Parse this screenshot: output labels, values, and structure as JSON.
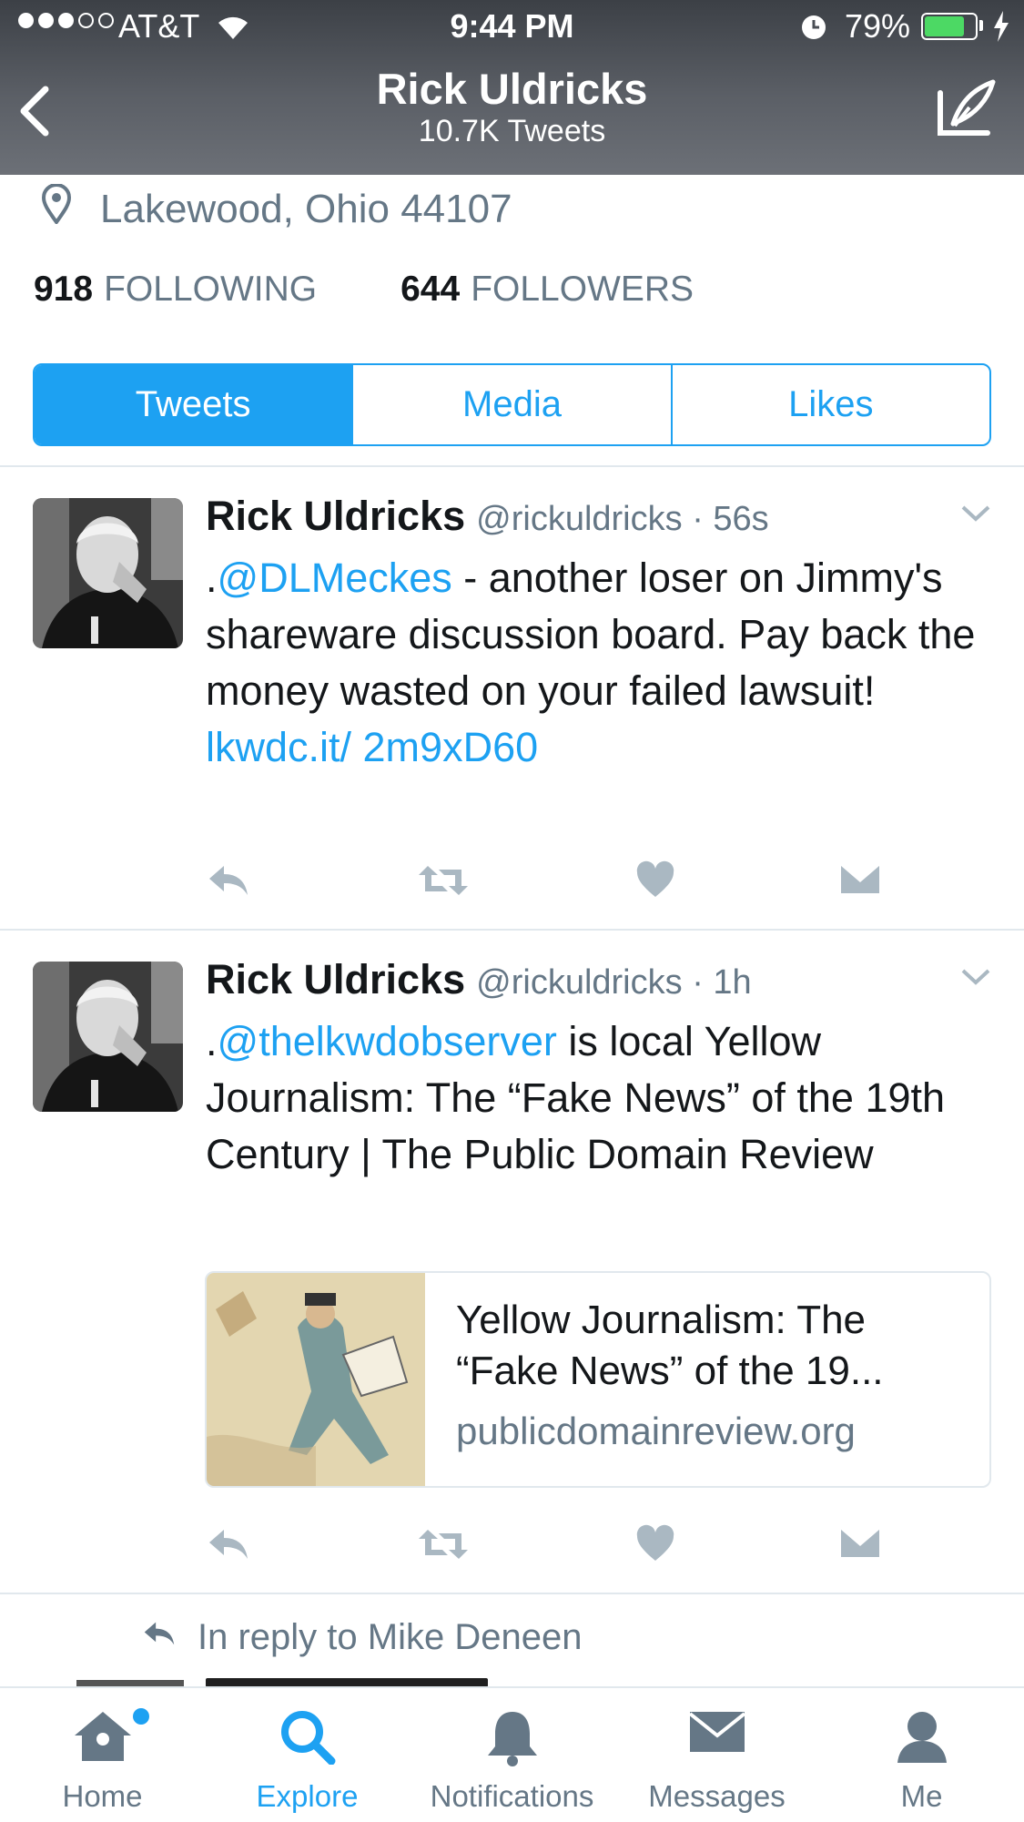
{
  "status_bar": {
    "carrier": "AT&T",
    "time": "9:44 PM",
    "battery": "79%",
    "battery_level": 0.79,
    "signal_bars_filled": 3,
    "signal_bars_total": 5
  },
  "header": {
    "title": "Rick Uldricks",
    "subtitle": "10.7K Tweets"
  },
  "profile": {
    "location": "Lakewood, Ohio 44107",
    "following_count": "918",
    "following_label": "FOLLOWING",
    "followers_count": "644",
    "followers_label": "FOLLOWERS"
  },
  "tabs": [
    "Tweets",
    "Media",
    "Likes"
  ],
  "active_tab": "Tweets",
  "tweets": [
    {
      "name": "Rick Uldricks",
      "handle": "@rickuldricks",
      "sep": "·",
      "time": "56s",
      "prefix": ".",
      "mention": "@DLMeckes",
      "text": " - another loser on Jimmy's shareware discussion board. Pay back the money wasted on your failed lawsuit! ",
      "link": "lkwdc.it/ 2m9xD60"
    },
    {
      "name": "Rick Uldricks",
      "handle": "@rickuldricks",
      "sep": "·",
      "time": "1h",
      "prefix": ".",
      "mention": "@thelkwdobserver",
      "text": " is local Yellow Journalism: The “Fake News” of the 19th Century | The Public Domain Review",
      "card": {
        "title": "Yellow Journalism: The “Fake News” of the 19...",
        "domain": "publicdomainreview.org"
      }
    }
  ],
  "reply_context": "In reply to Mike Deneen",
  "bottom_nav": [
    {
      "label": "Home",
      "icon": "home-icon"
    },
    {
      "label": "Explore",
      "icon": "search-icon"
    },
    {
      "label": "Notifications",
      "icon": "bell-icon"
    },
    {
      "label": "Messages",
      "icon": "envelope-icon"
    },
    {
      "label": "Me",
      "icon": "person-icon"
    }
  ],
  "active_nav": "Explore",
  "colors": {
    "accent": "#1da1f2",
    "secondary_text": "#657786",
    "battery": "#4cd964"
  }
}
